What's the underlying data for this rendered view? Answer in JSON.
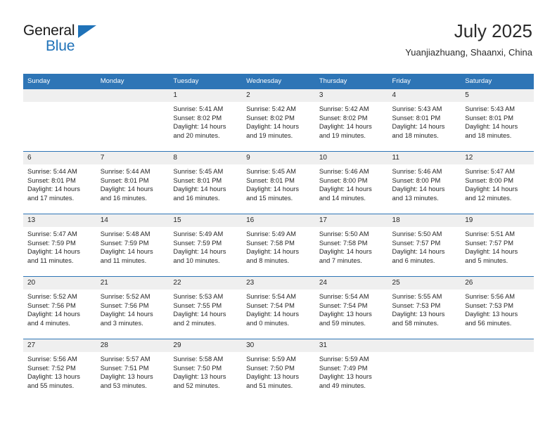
{
  "brand": {
    "name_top": "General",
    "name_bottom": "Blue",
    "accent_color": "#1f72b8"
  },
  "header": {
    "title": "July 2025",
    "subtitle": "Yuanjiazhuang, Shaanxi, China"
  },
  "theme": {
    "header_bg": "#2e75b6",
    "daynum_bg": "#efefef",
    "text": "#262626"
  },
  "weekdays": [
    "Sunday",
    "Monday",
    "Tuesday",
    "Wednesday",
    "Thursday",
    "Friday",
    "Saturday"
  ],
  "weeks": [
    [
      {
        "day": "",
        "sunrise": "",
        "sunset": "",
        "daylight": ""
      },
      {
        "day": "",
        "sunrise": "",
        "sunset": "",
        "daylight": ""
      },
      {
        "day": "1",
        "sunrise": "Sunrise: 5:41 AM",
        "sunset": "Sunset: 8:02 PM",
        "daylight": "Daylight: 14 hours and 20 minutes."
      },
      {
        "day": "2",
        "sunrise": "Sunrise: 5:42 AM",
        "sunset": "Sunset: 8:02 PM",
        "daylight": "Daylight: 14 hours and 19 minutes."
      },
      {
        "day": "3",
        "sunrise": "Sunrise: 5:42 AM",
        "sunset": "Sunset: 8:02 PM",
        "daylight": "Daylight: 14 hours and 19 minutes."
      },
      {
        "day": "4",
        "sunrise": "Sunrise: 5:43 AM",
        "sunset": "Sunset: 8:01 PM",
        "daylight": "Daylight: 14 hours and 18 minutes."
      },
      {
        "day": "5",
        "sunrise": "Sunrise: 5:43 AM",
        "sunset": "Sunset: 8:01 PM",
        "daylight": "Daylight: 14 hours and 18 minutes."
      }
    ],
    [
      {
        "day": "6",
        "sunrise": "Sunrise: 5:44 AM",
        "sunset": "Sunset: 8:01 PM",
        "daylight": "Daylight: 14 hours and 17 minutes."
      },
      {
        "day": "7",
        "sunrise": "Sunrise: 5:44 AM",
        "sunset": "Sunset: 8:01 PM",
        "daylight": "Daylight: 14 hours and 16 minutes."
      },
      {
        "day": "8",
        "sunrise": "Sunrise: 5:45 AM",
        "sunset": "Sunset: 8:01 PM",
        "daylight": "Daylight: 14 hours and 16 minutes."
      },
      {
        "day": "9",
        "sunrise": "Sunrise: 5:45 AM",
        "sunset": "Sunset: 8:01 PM",
        "daylight": "Daylight: 14 hours and 15 minutes."
      },
      {
        "day": "10",
        "sunrise": "Sunrise: 5:46 AM",
        "sunset": "Sunset: 8:00 PM",
        "daylight": "Daylight: 14 hours and 14 minutes."
      },
      {
        "day": "11",
        "sunrise": "Sunrise: 5:46 AM",
        "sunset": "Sunset: 8:00 PM",
        "daylight": "Daylight: 14 hours and 13 minutes."
      },
      {
        "day": "12",
        "sunrise": "Sunrise: 5:47 AM",
        "sunset": "Sunset: 8:00 PM",
        "daylight": "Daylight: 14 hours and 12 minutes."
      }
    ],
    [
      {
        "day": "13",
        "sunrise": "Sunrise: 5:47 AM",
        "sunset": "Sunset: 7:59 PM",
        "daylight": "Daylight: 14 hours and 11 minutes."
      },
      {
        "day": "14",
        "sunrise": "Sunrise: 5:48 AM",
        "sunset": "Sunset: 7:59 PM",
        "daylight": "Daylight: 14 hours and 11 minutes."
      },
      {
        "day": "15",
        "sunrise": "Sunrise: 5:49 AM",
        "sunset": "Sunset: 7:59 PM",
        "daylight": "Daylight: 14 hours and 10 minutes."
      },
      {
        "day": "16",
        "sunrise": "Sunrise: 5:49 AM",
        "sunset": "Sunset: 7:58 PM",
        "daylight": "Daylight: 14 hours and 8 minutes."
      },
      {
        "day": "17",
        "sunrise": "Sunrise: 5:50 AM",
        "sunset": "Sunset: 7:58 PM",
        "daylight": "Daylight: 14 hours and 7 minutes."
      },
      {
        "day": "18",
        "sunrise": "Sunrise: 5:50 AM",
        "sunset": "Sunset: 7:57 PM",
        "daylight": "Daylight: 14 hours and 6 minutes."
      },
      {
        "day": "19",
        "sunrise": "Sunrise: 5:51 AM",
        "sunset": "Sunset: 7:57 PM",
        "daylight": "Daylight: 14 hours and 5 minutes."
      }
    ],
    [
      {
        "day": "20",
        "sunrise": "Sunrise: 5:52 AM",
        "sunset": "Sunset: 7:56 PM",
        "daylight": "Daylight: 14 hours and 4 minutes."
      },
      {
        "day": "21",
        "sunrise": "Sunrise: 5:52 AM",
        "sunset": "Sunset: 7:56 PM",
        "daylight": "Daylight: 14 hours and 3 minutes."
      },
      {
        "day": "22",
        "sunrise": "Sunrise: 5:53 AM",
        "sunset": "Sunset: 7:55 PM",
        "daylight": "Daylight: 14 hours and 2 minutes."
      },
      {
        "day": "23",
        "sunrise": "Sunrise: 5:54 AM",
        "sunset": "Sunset: 7:54 PM",
        "daylight": "Daylight: 14 hours and 0 minutes."
      },
      {
        "day": "24",
        "sunrise": "Sunrise: 5:54 AM",
        "sunset": "Sunset: 7:54 PM",
        "daylight": "Daylight: 13 hours and 59 minutes."
      },
      {
        "day": "25",
        "sunrise": "Sunrise: 5:55 AM",
        "sunset": "Sunset: 7:53 PM",
        "daylight": "Daylight: 13 hours and 58 minutes."
      },
      {
        "day": "26",
        "sunrise": "Sunrise: 5:56 AM",
        "sunset": "Sunset: 7:53 PM",
        "daylight": "Daylight: 13 hours and 56 minutes."
      }
    ],
    [
      {
        "day": "27",
        "sunrise": "Sunrise: 5:56 AM",
        "sunset": "Sunset: 7:52 PM",
        "daylight": "Daylight: 13 hours and 55 minutes."
      },
      {
        "day": "28",
        "sunrise": "Sunrise: 5:57 AM",
        "sunset": "Sunset: 7:51 PM",
        "daylight": "Daylight: 13 hours and 53 minutes."
      },
      {
        "day": "29",
        "sunrise": "Sunrise: 5:58 AM",
        "sunset": "Sunset: 7:50 PM",
        "daylight": "Daylight: 13 hours and 52 minutes."
      },
      {
        "day": "30",
        "sunrise": "Sunrise: 5:59 AM",
        "sunset": "Sunset: 7:50 PM",
        "daylight": "Daylight: 13 hours and 51 minutes."
      },
      {
        "day": "31",
        "sunrise": "Sunrise: 5:59 AM",
        "sunset": "Sunset: 7:49 PM",
        "daylight": "Daylight: 13 hours and 49 minutes."
      },
      {
        "day": "",
        "sunrise": "",
        "sunset": "",
        "daylight": ""
      },
      {
        "day": "",
        "sunrise": "",
        "sunset": "",
        "daylight": ""
      }
    ]
  ]
}
